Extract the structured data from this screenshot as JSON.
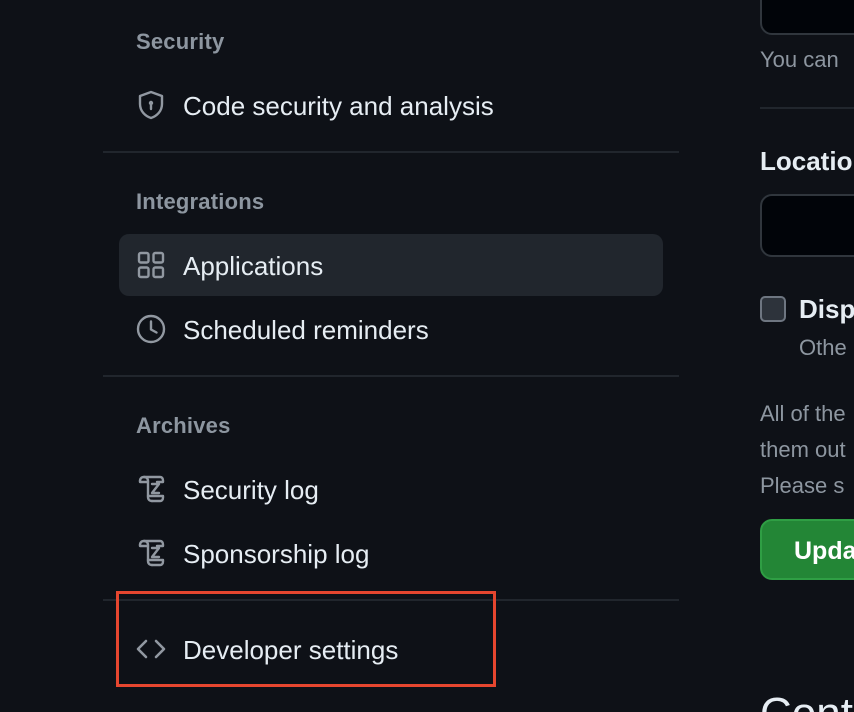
{
  "sidebar": {
    "sections": {
      "security": {
        "heading": "Security",
        "items": [
          {
            "label": "Code security and analysis",
            "icon": "shield-lock-icon"
          }
        ]
      },
      "integrations": {
        "heading": "Integrations",
        "items": [
          {
            "label": "Applications",
            "icon": "apps-icon",
            "active": true
          },
          {
            "label": "Scheduled reminders",
            "icon": "clock-icon"
          }
        ]
      },
      "archives": {
        "heading": "Archives",
        "items": [
          {
            "label": "Security log",
            "icon": "log-icon"
          },
          {
            "label": "Sponsorship log",
            "icon": "log-icon"
          }
        ]
      },
      "developer": {
        "items": [
          {
            "label": "Developer settings",
            "icon": "code-icon",
            "highlighted": true
          }
        ]
      }
    }
  },
  "content": {
    "hint_text": "You can",
    "location_label": "Locatio",
    "checkbox_label": "Disp",
    "checkbox_hint": "Othe",
    "paragraph_lines": [
      "All of the",
      "them out",
      "Please s"
    ],
    "update_button_label": "Upda",
    "next_heading": "Cont"
  },
  "colors": {
    "background": "#0e1117",
    "text": "#e6edf3",
    "muted": "#8d96a0",
    "active_bg": "#21262d",
    "highlight_border": "#e5462f",
    "button_green": "#238636"
  }
}
